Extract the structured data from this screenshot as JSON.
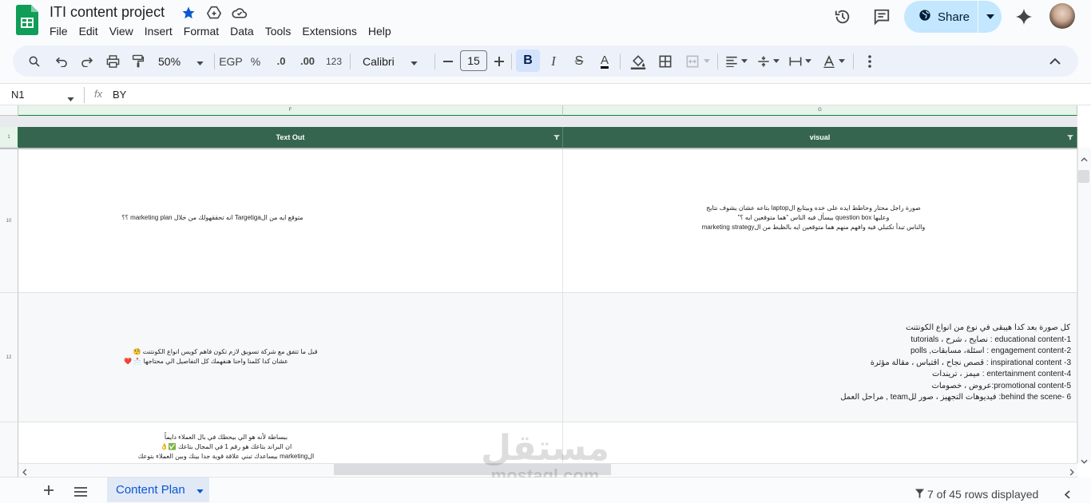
{
  "app": {
    "doc_title": "ITI content project",
    "menu": [
      "File",
      "Edit",
      "View",
      "Insert",
      "Format",
      "Data",
      "Tools",
      "Extensions",
      "Help"
    ],
    "share_label": "Share"
  },
  "toolbar": {
    "zoom": "50%",
    "currency": "EGP",
    "percent": "%",
    "dec_decrease": ".0",
    "dec_increase": ".00",
    "format_123": "123",
    "font": "Calibri",
    "font_size": "15",
    "bold": "B",
    "italic": "I",
    "strike": "S",
    "text_color": "A"
  },
  "formula": {
    "name_box": "N1",
    "fx": "fx",
    "value": "BY"
  },
  "grid": {
    "columns": [
      {
        "letter": "F"
      },
      {
        "letter": "G"
      }
    ],
    "rows": [
      "1",
      "10",
      "12"
    ],
    "headers": [
      "Text Out",
      "visual"
    ],
    "row10": {
      "text_out": "متوقع ايه من الTargetiga انه تحققهولك من خلال marketing plan ؟؟",
      "visual": [
        "صورة راجل محتار وحاطط ايده على خده وبيتابع الlaptop بتاعه عشان يشوف نتايج",
        "وعليها question box بيسأل فيه الناس \"هما متوقعين ايه ؟\"",
        "والناس تبدأ تكتبلي فيه وافهم منهم هما متوقعين ايه بالظبط من الmarketing strategy"
      ]
    },
    "row12": {
      "text_out": [
        "قبل ما تتفق مع شركة تسويق لازم تكون فاهم كويس انواع الكونتنت 🧐",
        "عشان كدا كلمنا واحنا هنفهمك كل التفاصيل الي محتاجها 📩 ❤️"
      ],
      "visual": [
        "كل صورة بعد كدا هيبقى في نوع من انواع الكونتنت",
        "1-educational content : نصايح ، شرح ، tutorials",
        "2-engagement content : اسئلة، مسابقات, polls",
        "3- inspirational content : قصص نجاح ، اقتباس ، مقالة مؤثرة",
        "4-entertainment content : ميمز ، تريندات",
        "5-promotional content:عروض ، خصومات",
        "6 -behind the scene: فيديوهات التجهيز ، صور للteam , مراحل العمل"
      ]
    },
    "row13": {
      "text_out": [
        "ببساطة لأنه هو الي بيحطك في بال العملاء دايماً",
        "ان البراند بتاعك هو رقم 1 في المجال بتاعك ✅👌",
        "الmarketing بيساعدك تبني علاقة قوية جدا بينك وبين العملاء بتوعك"
      ]
    }
  },
  "bottom": {
    "sheet_tab": "Content Plan",
    "rows_displayed": "7 of 45 rows displayed"
  },
  "watermark": {
    "arabic": "مستقل",
    "latin": "mostaql.com"
  }
}
